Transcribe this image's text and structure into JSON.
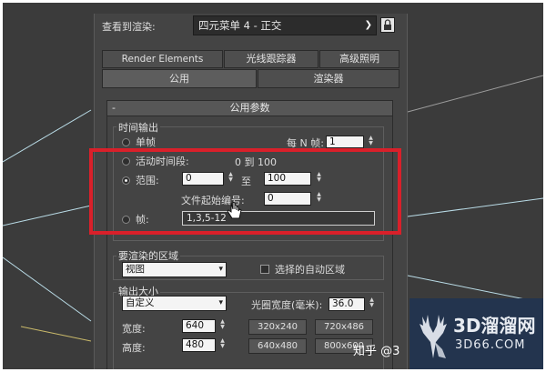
{
  "header": {
    "view_label": "查看到渲染:",
    "view_value": "四元菜单 4 - 正交",
    "lock_icon": "lock-icon"
  },
  "tabs": {
    "row1": [
      "Render Elements",
      "光线跟踪器",
      "高级照明"
    ],
    "row2": [
      "公用",
      "渲染器"
    ]
  },
  "rollout": {
    "title": "公用参数",
    "collapse": "-"
  },
  "time_output": {
    "title": "时间输出",
    "single": "单帧",
    "every_n_label": "每 N 帧:",
    "every_n_value": "1",
    "active_segment": "活动时间段:",
    "active_range": "0 到 100",
    "range_label": "范围:",
    "range_from": "0",
    "range_to_label": "至",
    "range_to": "100",
    "file_start_label": "文件起始编号:",
    "file_start": "0",
    "frames_label": "帧:",
    "frames_value": "1,3,5-12"
  },
  "area": {
    "title": "要渲染的区域",
    "select_value": "视图",
    "auto_region": "选择的自动区域"
  },
  "output_size": {
    "title": "输出大小",
    "preset": "自定义",
    "aperture_label": "光圈宽度(毫米):",
    "aperture_value": "36.0",
    "width_label": "宽度:",
    "width_value": "640",
    "height_label": "高度:",
    "height_value": "480",
    "presets": [
      "320x240",
      "720x486",
      "640x480",
      "800x600"
    ]
  },
  "watermark": {
    "zhihu": "知乎 @3",
    "brand_cn": "3D溜溜网",
    "brand_url": "3D66.COM"
  },
  "colors": {
    "highlight": "#d9202a",
    "panel": "#444444",
    "viewport": "#3b3b3b",
    "watermark_bg": "#23344e"
  }
}
